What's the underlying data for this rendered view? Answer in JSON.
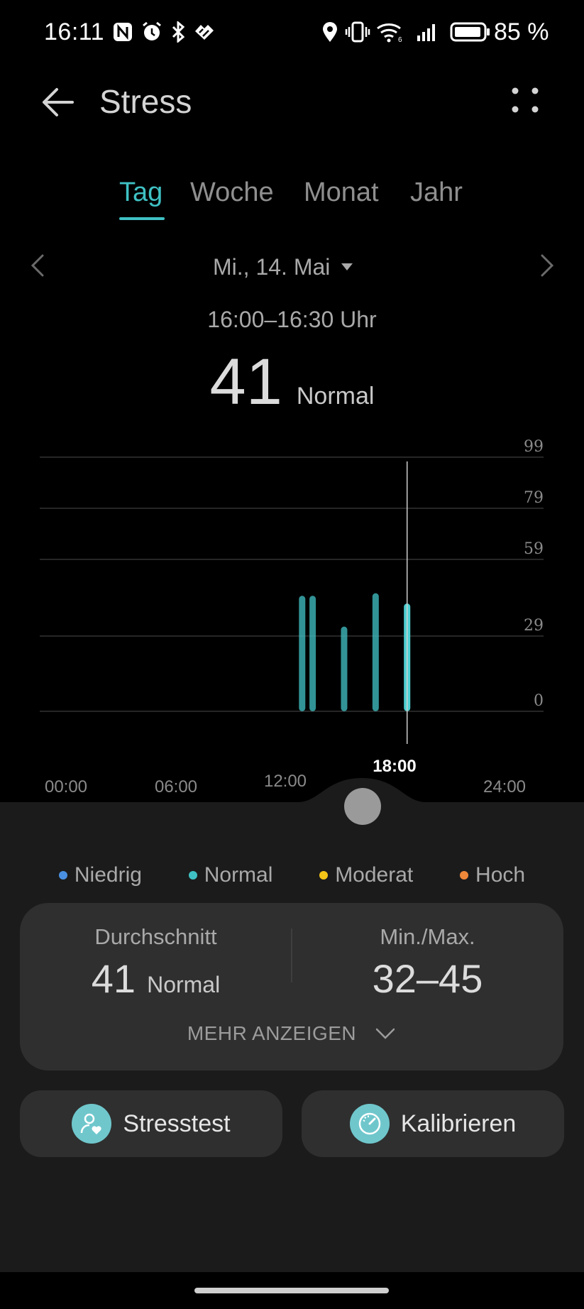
{
  "status_bar": {
    "time": "16:11",
    "battery_percent": "85 %",
    "icons": [
      "nfc-icon",
      "alarm-icon",
      "bluetooth-icon",
      "health-sync-icon",
      "location-icon",
      "vibrate-icon",
      "wifi-icon",
      "signal-icon",
      "battery-icon"
    ]
  },
  "header": {
    "title": "Stress",
    "back_icon": "arrow-left-icon",
    "more_icon": "four-dots-icon"
  },
  "tabs": [
    {
      "label": "Tag",
      "active": true
    },
    {
      "label": "Woche",
      "active": false
    },
    {
      "label": "Monat",
      "active": false
    },
    {
      "label": "Jahr",
      "active": false
    }
  ],
  "date_nav": {
    "date": "Mi., 14. Mai",
    "time_range": "16:00–16:30 Uhr"
  },
  "current": {
    "value": "41",
    "level": "Normal"
  },
  "chart_data": {
    "type": "bar",
    "x_unit": "hour",
    "y_ticks": [
      "99",
      "79",
      "59",
      "29",
      "0"
    ],
    "x_ticks": [
      "00:00",
      "06:00",
      "12:00",
      "18:00",
      "24:00"
    ],
    "ylim": [
      0,
      99
    ],
    "xlim": [
      0,
      24
    ],
    "bars": [
      {
        "x": 12.5,
        "value": 45
      },
      {
        "x": 13.0,
        "value": 45
      },
      {
        "x": 14.5,
        "value": 33
      },
      {
        "x": 16.0,
        "value": 46
      },
      {
        "x": 17.5,
        "value": 42
      }
    ],
    "cursor_x": 17.5,
    "cursor_label": "18:00",
    "bar_color": "#3fb8bb",
    "selected_bar_color": "#4dd0d2",
    "grid": true
  },
  "legend": [
    {
      "label": "Niedrig",
      "color": "#4a90e2"
    },
    {
      "label": "Normal",
      "color": "#3fc1c4"
    },
    {
      "label": "Moderat",
      "color": "#f5c518"
    },
    {
      "label": "Hoch",
      "color": "#f0883a"
    }
  ],
  "summary": {
    "average_label": "Durchschnitt",
    "average_value": "41",
    "average_level": "Normal",
    "minmax_label": "Min./Max.",
    "minmax_value": "32–45",
    "more_label": "MEHR ANZEIGEN"
  },
  "actions": {
    "stresstest_label": "Stresstest",
    "calibrate_label": "Kalibrieren"
  }
}
